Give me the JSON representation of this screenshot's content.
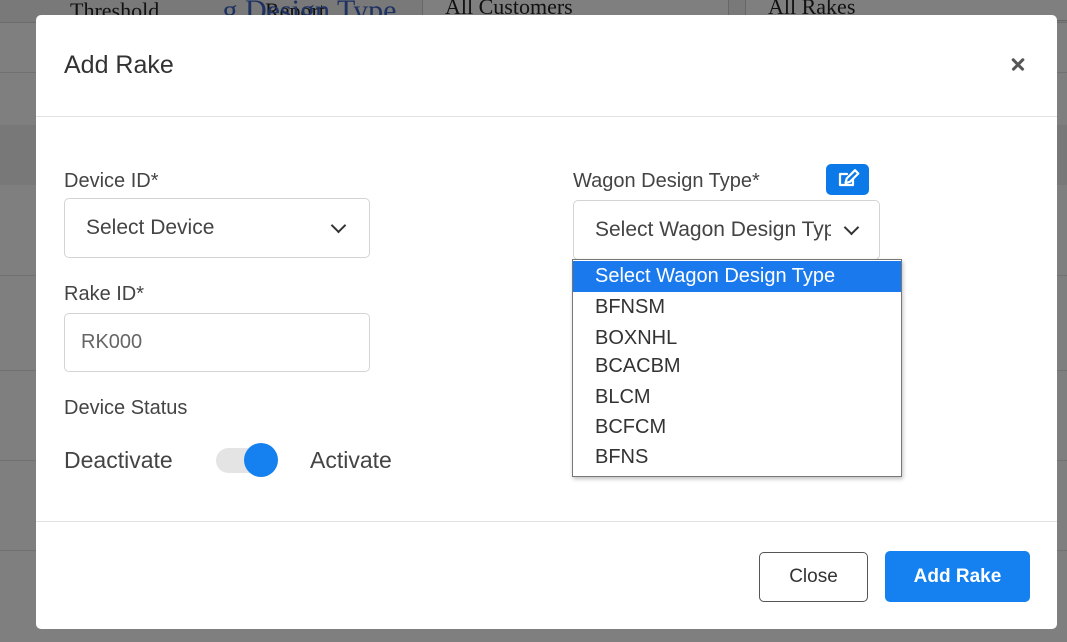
{
  "background": {
    "toolbar_items": [
      "Threshold",
      "Report",
      "All Customers",
      "All Rakes"
    ],
    "overflow_text": "...g Design Type"
  },
  "modal": {
    "title": "Add Rake",
    "close_icon": "close-icon",
    "device_id": {
      "label": "Device ID*",
      "selected": "Select Device"
    },
    "rake_id": {
      "label": "Rake ID*",
      "placeholder": "RK000"
    },
    "device_status": {
      "label": "Device Status",
      "off_label": "Deactivate",
      "on_label": "Activate",
      "state": "on"
    },
    "wagon_design_type": {
      "label": "Wagon Design Type*",
      "edit_icon": "edit-icon",
      "selected": "Select Wagon Design Type",
      "options": [
        "Select Wagon Design Type",
        "BFNSM",
        "BOXNHL",
        "BCACBM",
        "BLCM",
        "BCFCM",
        "BFNS"
      ]
    },
    "footer": {
      "close_label": "Close",
      "add_label": "Add Rake"
    }
  },
  "colors": {
    "primary": "#1580ef",
    "overlay": "rgba(0,0,0,0.5)"
  }
}
